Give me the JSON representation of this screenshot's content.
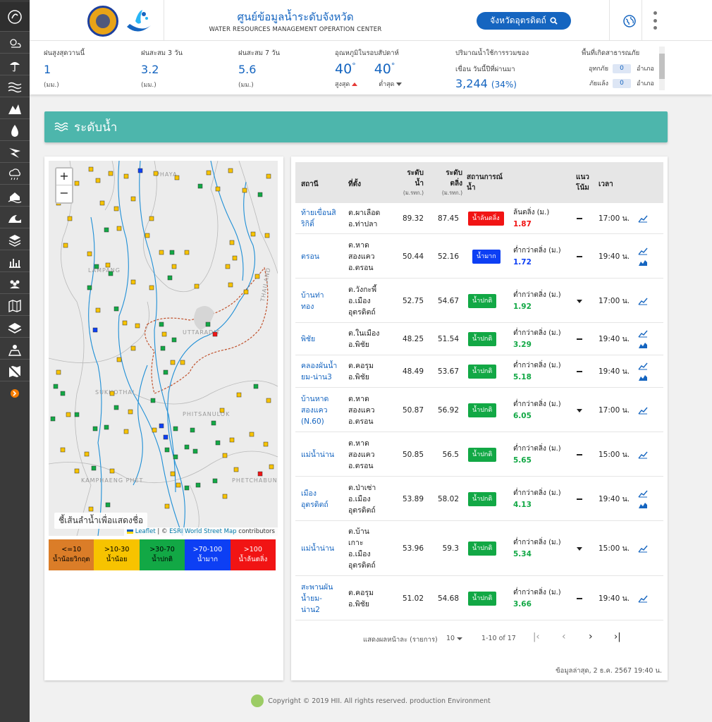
{
  "sidebar": {
    "icons": [
      "app-logo-icon",
      "weather-icon",
      "rain-icon",
      "water-wave-icon",
      "water-level-icon",
      "water-drop-icon",
      "storm-icon",
      "cloud-rain-icon",
      "flood-icon",
      "wave-icon",
      "layers-stack-icon",
      "chart-icon",
      "community-icon",
      "map-book-icon",
      "layers-icon",
      "map-person-icon",
      "map-off-icon",
      "expand-arrow-icon"
    ]
  },
  "header": {
    "title": "ศูนย์ข้อมูลน้ำระดับจังหวัด",
    "subtitle": "WATER RESOURCES MANAGEMENT OPERATION CENTER",
    "province_button": "จังหวัดอุตรดิตถ์"
  },
  "stats": {
    "rain_max": {
      "label": "ฝนสูงสุดวานนี้",
      "value": "1",
      "unit": "(มม.)"
    },
    "rain_3d": {
      "label": "ฝนสะสม 3 วัน",
      "value": "3.2",
      "unit": "(มม.)"
    },
    "rain_7d": {
      "label": "ฝนสะสม 7 วัน",
      "value": "5.6",
      "unit": "(มม.)"
    },
    "temp": {
      "label": "อุณหภูมิในรอบสัปดาห์",
      "high": "40",
      "low": "40",
      "high_label": "สูงสุด",
      "low_label": "ต่ำสุด",
      "degree": "°"
    },
    "dam": {
      "label": "ปริมาณน้ำใช้การรวมของ",
      "label2": "เขื่อน วันนี้ปีที่ผ่านมา",
      "value": "3,244",
      "percent": "(34%)"
    },
    "disaster": {
      "label": "พื้นที่เกิดสาธารณภัย",
      "rows": [
        {
          "name": "อุทกภัย",
          "count": "0",
          "unit": "อำเภอ"
        },
        {
          "name": "ภัยแล้ง",
          "count": "0",
          "unit": "อำเภอ"
        }
      ]
    }
  },
  "section": {
    "title": "ระดับน้ำ"
  },
  "map": {
    "zoom_in": "+",
    "zoom_out": "−",
    "tip": "ชี้เส้นลำน้ำเพื่อแสดงชื่อ",
    "attrib_leaflet": "Leaflet",
    "attrib_sep": " | © ",
    "attrib_esri": "ESRI World Street Map",
    "attrib_end": " contributors",
    "place_labels": [
      "PHAYA",
      "LAMPANG",
      "UTTARADIT",
      "SUKHOTHAI",
      "PHITSANULOK",
      "KAMPHAENG PHET",
      "PHETCHABUN",
      "THAILAND"
    ],
    "legend": [
      {
        "range": "<=10",
        "label": "น้ำน้อยวิกฤต",
        "color": "#db7d28"
      },
      {
        "range": ">10-30",
        "label": "น้ำน้อย",
        "color": "#f7c300"
      },
      {
        "range": ">30-70",
        "label": "น้ำปกติ",
        "color": "#12a845"
      },
      {
        "range": ">70-100",
        "label": "น้ำมาก",
        "color": "#0d3ff4"
      },
      {
        "range": ">100",
        "label": "น้ำล้นตลิ่ง",
        "color": "#f11414"
      }
    ]
  },
  "table": {
    "headers": {
      "station": "สถานี",
      "location": "ที่ตั้ง",
      "water_level": "ระดับ น้ำ",
      "water_level_unit": "(ม.รทก.)",
      "bank_level": "ระดับ ตลิ่ง",
      "bank_level_unit": "(ม.รทก.)",
      "situation": "สถานการณ์ น้ำ",
      "trend": "แนว โน้ม",
      "time": "เวลา"
    },
    "rows": [
      {
        "station": [
          "ท้ายเขื่อนสิ",
          "ริกิติ์"
        ],
        "location": [
          "ต.ผาเลือด",
          "อ.ท่าปลา"
        ],
        "water": "89.32",
        "bank": "87.45",
        "status": "น้ำล้นตลิ่ง",
        "status_color": "#f11414",
        "sit_label": "ล้นตลิ่ง (ม.)",
        "sit_value": "1.87",
        "sit_color": "#f11414",
        "trend": "dash",
        "time": "17:00 น.",
        "icons": [
          "line-chart-icon"
        ]
      },
      {
        "station": [
          "ตรอน"
        ],
        "location": [
          "ต.หาด",
          "สองแคว",
          "อ.ตรอน"
        ],
        "water": "50.44",
        "bank": "52.16",
        "status": "น้ำมาก",
        "status_color": "#0d3ff4",
        "sit_label": "ต่ำกว่าตลิ่ง (ม.)",
        "sit_value": "1.72",
        "sit_color": "#0d3ff4",
        "trend": "dash",
        "time": "19:40 น.",
        "icons": [
          "line-chart-icon",
          "area-chart-icon"
        ]
      },
      {
        "station": [
          "บ้านท่า",
          "ทอง"
        ],
        "location": [
          "ต.วังกะพี้",
          "อ.เมือง",
          "อุตรดิตถ์"
        ],
        "water": "52.75",
        "bank": "54.67",
        "status": "น้ำปกติ",
        "status_color": "#12a845",
        "sit_label": "ต่ำกว่าตลิ่ง (ม.)",
        "sit_value": "1.92",
        "sit_color": "#12a845",
        "trend": "down",
        "time": "17:00 น.",
        "icons": [
          "line-chart-icon"
        ]
      },
      {
        "station": [
          "พิชัย"
        ],
        "location": [
          "ต.ในเมือง",
          "อ.พิชัย"
        ],
        "water": "48.25",
        "bank": "51.54",
        "status": "น้ำปกติ",
        "status_color": "#12a845",
        "sit_label": "ต่ำกว่าตลิ่ง (ม.)",
        "sit_value": "3.29",
        "sit_color": "#12a845",
        "trend": "dash",
        "time": "19:40 น.",
        "icons": [
          "line-chart-icon",
          "area-chart-icon"
        ]
      },
      {
        "station": [
          "คลองผันน้ำ",
          "ยม-น่าน3"
        ],
        "location": [
          "ต.คอรุม",
          "อ.พิชัย"
        ],
        "water": "48.49",
        "bank": "53.67",
        "status": "น้ำปกติ",
        "status_color": "#12a845",
        "sit_label": "ต่ำกว่าตลิ่ง (ม.)",
        "sit_value": "5.18",
        "sit_color": "#12a845",
        "trend": "dash",
        "time": "19:40 น.",
        "icons": [
          "line-chart-icon",
          "area-chart-icon"
        ]
      },
      {
        "station": [
          "บ้านหาด",
          "สองแคว",
          "(N.60)"
        ],
        "location": [
          "ต.หาด",
          "สองแคว",
          "อ.ตรอน"
        ],
        "water": "50.87",
        "bank": "56.92",
        "status": "น้ำปกติ",
        "status_color": "#12a845",
        "sit_label": "ต่ำกว่าตลิ่ง (ม.)",
        "sit_value": "6.05",
        "sit_color": "#12a845",
        "trend": "down",
        "time": "17:00 น.",
        "icons": [
          "line-chart-icon"
        ]
      },
      {
        "station": [
          "แม่น้ำน่าน"
        ],
        "location": [
          "ต.หาด",
          "สองแคว",
          "อ.ตรอน"
        ],
        "water": "50.85",
        "bank": "56.5",
        "status": "น้ำปกติ",
        "status_color": "#12a845",
        "sit_label": "ต่ำกว่าตลิ่ง (ม.)",
        "sit_value": "5.65",
        "sit_color": "#12a845",
        "trend": "dash",
        "time": "15:00 น.",
        "icons": [
          "line-chart-icon"
        ]
      },
      {
        "station": [
          "เมือง",
          "อุตรดิตถ์"
        ],
        "location": [
          "ต.ป่าเซ่า",
          "อ.เมือง",
          "อุตรดิตถ์"
        ],
        "water": "53.89",
        "bank": "58.02",
        "status": "น้ำปกติ",
        "status_color": "#12a845",
        "sit_label": "ต่ำกว่าตลิ่ง (ม.)",
        "sit_value": "4.13",
        "sit_color": "#12a845",
        "trend": "dash",
        "time": "19:40 น.",
        "icons": [
          "line-chart-icon",
          "area-chart-icon"
        ]
      },
      {
        "station": [
          "แม่น้ำน่าน"
        ],
        "location": [
          "ต.บ้าน",
          "เกาะ",
          "อ.เมือง",
          "อุตรดิตถ์"
        ],
        "water": "53.96",
        "bank": "59.3",
        "status": "น้ำปกติ",
        "status_color": "#12a845",
        "sit_label": "ต่ำกว่าตลิ่ง (ม.)",
        "sit_value": "5.34",
        "sit_color": "#12a845",
        "trend": "down",
        "time": "15:00 น.",
        "icons": [
          "line-chart-icon"
        ]
      },
      {
        "station": [
          "สะพานผัน",
          "น้ำยม-",
          "น่าน2"
        ],
        "location": [
          "ต.คอรุม",
          "อ.พิชัย"
        ],
        "water": "51.02",
        "bank": "54.68",
        "status": "น้ำปกติ",
        "status_color": "#12a845",
        "sit_label": "ต่ำกว่าตลิ่ง (ม.)",
        "sit_value": "3.66",
        "sit_color": "#12a845",
        "trend": "dash",
        "time": "19:40 น.",
        "icons": [
          "line-chart-icon"
        ]
      }
    ],
    "pager": {
      "rows_label": "แสดงผลหน้าละ (รายการ)",
      "rows_value": "10",
      "range": "1-10 of 17",
      "first": "|‹",
      "prev": "‹",
      "next": "›",
      "last": "›|"
    },
    "updated": "ข้อมูลล่าสุด, 2 ธ.ค. 2567 19:40 น."
  },
  "footer": {
    "text": "Copyright © 2019 HII. All rights reserved. production Environment"
  },
  "colors": {
    "accent": "#1565c0",
    "section": "#4db6ac",
    "sidebar": "#3a3a3a"
  }
}
